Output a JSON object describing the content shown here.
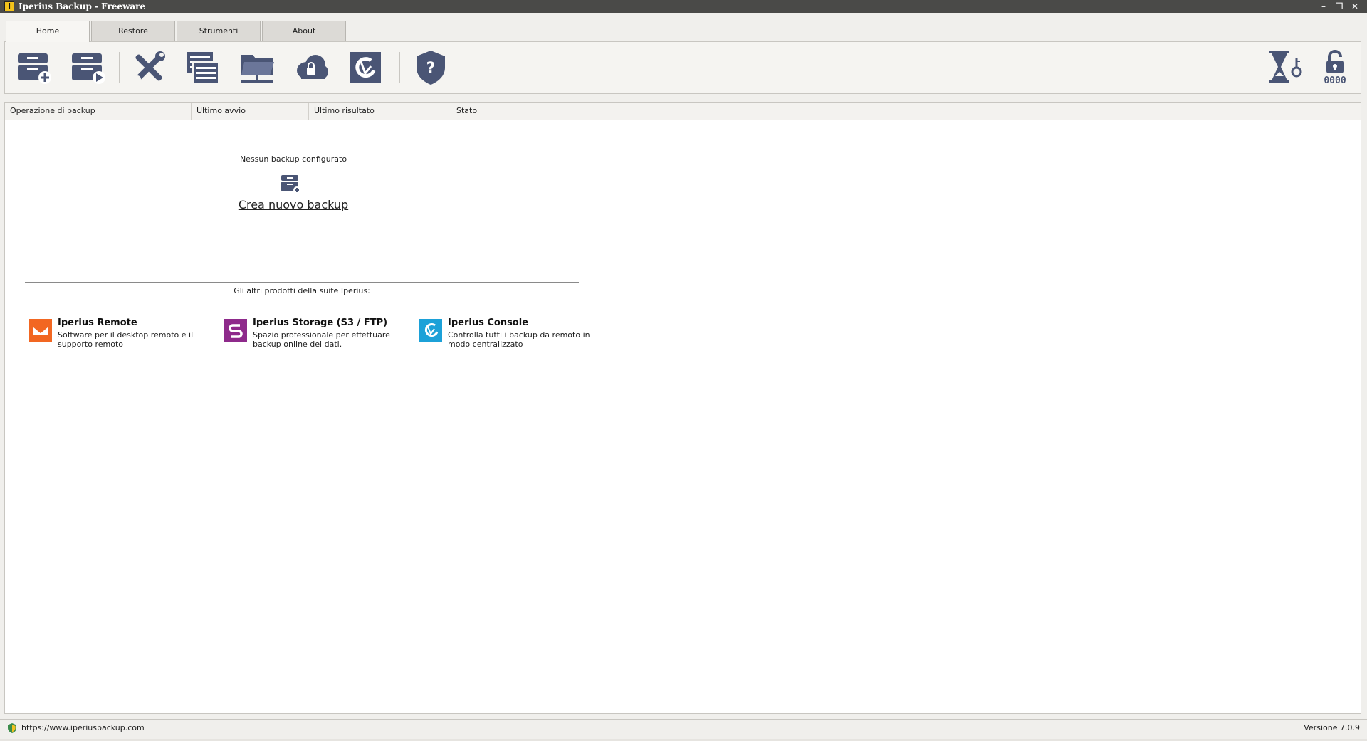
{
  "window": {
    "title": "Iperius Backup - Freeware",
    "logo_letter": "I",
    "controls": {
      "minimize": "–",
      "maximize": "❐",
      "close": "✕"
    }
  },
  "tabs": [
    {
      "label": "Home",
      "active": true
    },
    {
      "label": "Restore",
      "active": false
    },
    {
      "label": "Strumenti",
      "active": false
    },
    {
      "label": "About",
      "active": false
    }
  ],
  "toolbar": {
    "icon_color": "#4a5575",
    "buttons": [
      {
        "icon": "new-backup-icon"
      },
      {
        "icon": "run-backup-icon"
      },
      {
        "icon": "tools-icon"
      },
      {
        "icon": "log-list-icon"
      },
      {
        "icon": "network-folder-icon"
      },
      {
        "icon": "cloud-lock-icon"
      },
      {
        "icon": "iperius-console-icon"
      },
      {
        "icon": "help-shield-icon"
      },
      {
        "icon": "scheduler-key-icon"
      },
      {
        "icon": "lock-pin-icon",
        "caption": "0000"
      }
    ]
  },
  "list": {
    "columns": [
      "Operazione di backup",
      "Ultimo avvio",
      "Ultimo risultato",
      "Stato"
    ],
    "empty_text": "Nessun backup configurato",
    "create_link": "Crea nuovo backup"
  },
  "suite": {
    "label": "Gli altri prodotti della suite Iperius:",
    "products": [
      {
        "name": "Iperius Remote",
        "description": "Software per il desktop remoto e il supporto remoto",
        "color": "#f26722"
      },
      {
        "name": "Iperius Storage (S3 / FTP)",
        "description": "Spazio professionale per effettuare backup online dei dati.",
        "color": "#8e2a8b"
      },
      {
        "name": "Iperius Console",
        "description": "Controlla tutti i backup da remoto in modo centralizzato",
        "color": "#1ca1d8"
      }
    ]
  },
  "statusbar": {
    "url": "https://www.iperiusbackup.com",
    "version": "Versione 7.0.9"
  }
}
